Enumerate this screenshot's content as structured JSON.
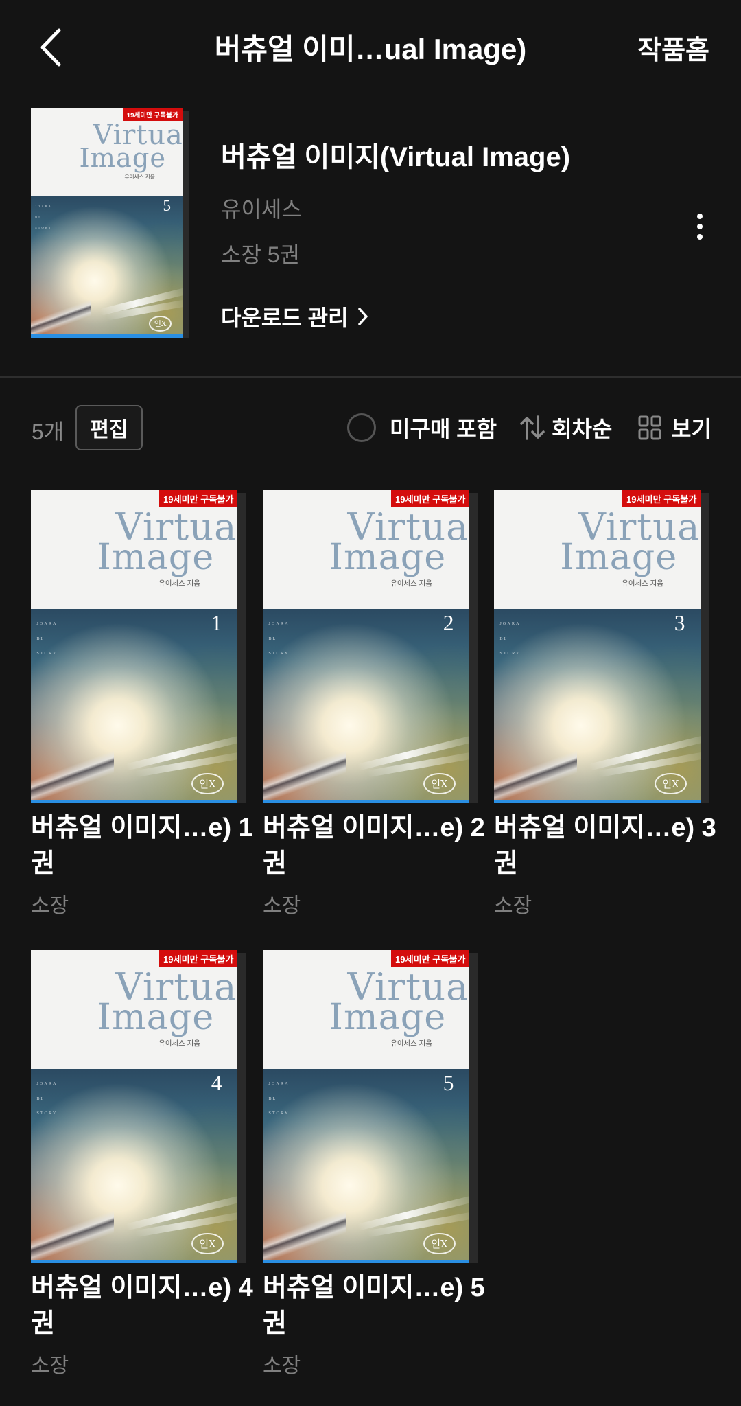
{
  "topbar": {
    "title": "버츄얼 이미…ual Image)",
    "home_label": "작품홈"
  },
  "cover_art": {
    "ribbon": "19세미만 구독불가",
    "title_line1": "Virtual",
    "title_line2": "Image",
    "author": "유이세스 지음",
    "side_text": [
      "JOARA",
      "BL",
      "STORY"
    ],
    "logo": "인X"
  },
  "header": {
    "book_title": "버츄얼 이미지(Virtual Image)",
    "author": "유이세스",
    "owned": "소장 5권",
    "download_label": "다운로드 관리",
    "cover_number": "5"
  },
  "toolbar": {
    "count": "5개",
    "edit_label": "편집",
    "unpurchased_label": "미구매 포함",
    "sort_label": "회차순",
    "view_label": "보기"
  },
  "volumes": [
    {
      "number": "1",
      "title": "버츄얼 이미지…e) 1권",
      "status": "소장"
    },
    {
      "number": "2",
      "title": "버츄얼 이미지…e) 2권",
      "status": "소장"
    },
    {
      "number": "3",
      "title": "버츄얼 이미지…e) 3권",
      "status": "소장"
    },
    {
      "number": "4",
      "title": "버츄얼 이미지…e) 4권",
      "status": "소장"
    },
    {
      "number": "5",
      "title": "버츄얼 이미지…e) 5권",
      "status": "소장"
    }
  ],
  "colors": {
    "background": "#141414",
    "ribbon": "#d40d0d",
    "progress": "#2a8fe3",
    "muted_text": "#808080"
  }
}
